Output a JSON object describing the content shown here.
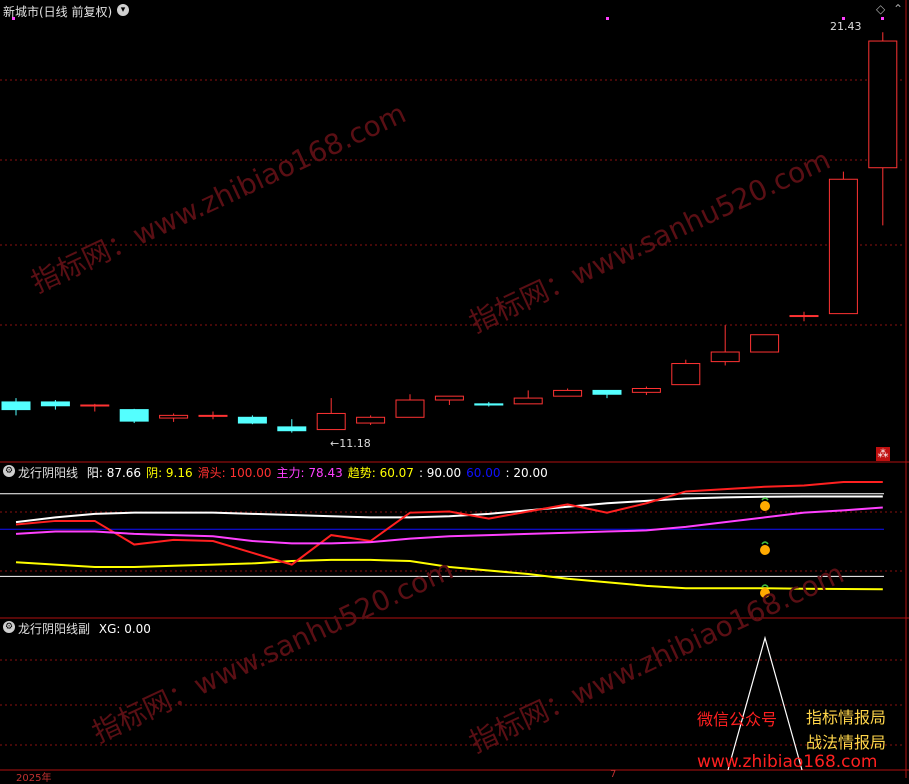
{
  "main_panel": {
    "title": "新城市(日线 前复权)",
    "price_high_label": "21.43",
    "price_low_label": "←11.18",
    "corner_icon": "diamond-icon",
    "collapse_icon": "chevron-down-icon",
    "close_badge_icon": "close-icon"
  },
  "indicator_panel": {
    "name": "龙行阴阳线",
    "items": [
      {
        "label": "阳:",
        "value": "87.66",
        "color": "#ffffff"
      },
      {
        "label": "阴:",
        "value": "9.16",
        "color": "#ffff00"
      },
      {
        "label": "滑头:",
        "value": "100.00",
        "color": "#ff3030"
      },
      {
        "label": "主力:",
        "value": "78.43",
        "color": "#ff40ff"
      },
      {
        "label": "趋势:",
        "value": "60.07",
        "color": "#ffff00"
      },
      {
        "label": "",
        "value": ": 90.00",
        "color": "#ffffff"
      },
      {
        "label": "",
        "value": "60.00",
        "color": "#1010ff"
      },
      {
        "label": "",
        "value": ": 20.00",
        "color": "#ffffff"
      }
    ]
  },
  "sub_panel": {
    "name": "龙行阴阳线副",
    "items": [
      {
        "label": "XG:",
        "value": "0.00",
        "color": "#ffffff"
      }
    ]
  },
  "watermarks": [
    "指标网：www.zhibiao168.com",
    "指标网：www.sanhu520.com",
    "指标网：www.sanhu520.com",
    "指标网：www.zhibiao168.com"
  ],
  "promo": {
    "wechat_label": "微信公众号",
    "account_1": "指标情报局",
    "account_2": "战法情报局",
    "site": "www.zhibiao168.com"
  },
  "bottom_axis": {
    "year": "2025年",
    "month": "7"
  },
  "colors": {
    "up": "#ff3333",
    "down": "#54ffff",
    "grid": "#8a1010"
  },
  "chart_data": {
    "type": "candlestick",
    "candles": [
      {
        "o": 11.8,
        "h": 11.9,
        "l": 11.45,
        "c": 11.6
      },
      {
        "o": 11.8,
        "h": 11.85,
        "l": 11.6,
        "c": 11.7
      },
      {
        "o": 11.7,
        "h": 11.75,
        "l": 11.55,
        "c": 11.72
      },
      {
        "o": 11.6,
        "h": 11.62,
        "l": 11.25,
        "c": 11.3
      },
      {
        "o": 11.38,
        "h": 11.5,
        "l": 11.28,
        "c": 11.45
      },
      {
        "o": 11.45,
        "h": 11.55,
        "l": 11.35,
        "c": 11.45
      },
      {
        "o": 11.4,
        "h": 11.45,
        "l": 11.22,
        "c": 11.25
      },
      {
        "o": 11.15,
        "h": 11.35,
        "l": 11.0,
        "c": 11.05
      },
      {
        "o": 11.08,
        "h": 11.9,
        "l": 11.08,
        "c": 11.5
      },
      {
        "o": 11.25,
        "h": 11.45,
        "l": 11.2,
        "c": 11.4
      },
      {
        "o": 11.4,
        "h": 12.0,
        "l": 11.4,
        "c": 11.85
      },
      {
        "o": 11.85,
        "h": 11.95,
        "l": 11.72,
        "c": 11.95
      },
      {
        "o": 11.75,
        "h": 11.8,
        "l": 11.68,
        "c": 11.72
      },
      {
        "o": 11.75,
        "h": 12.1,
        "l": 11.75,
        "c": 11.9
      },
      {
        "o": 11.95,
        "h": 12.15,
        "l": 11.95,
        "c": 12.1
      },
      {
        "o": 12.1,
        "h": 12.1,
        "l": 11.9,
        "c": 12.0
      },
      {
        "o": 12.05,
        "h": 12.2,
        "l": 11.98,
        "c": 12.15
      },
      {
        "o": 12.25,
        "h": 12.9,
        "l": 12.25,
        "c": 12.8
      },
      {
        "o": 12.85,
        "h": 13.8,
        "l": 12.75,
        "c": 13.1
      },
      {
        "o": 13.1,
        "h": 13.55,
        "l": 13.1,
        "c": 13.55
      },
      {
        "o": 14.05,
        "h": 14.15,
        "l": 13.9,
        "c": 14.05
      },
      {
        "o": 14.1,
        "h": 17.8,
        "l": 14.1,
        "c": 17.6
      },
      {
        "o": 17.9,
        "h": 21.43,
        "l": 16.4,
        "c": 21.2
      }
    ],
    "indicator": {
      "lines": {
        "yang": [
          66,
          70,
          73,
          74,
          74,
          74,
          73,
          72,
          71,
          70,
          70,
          71,
          73,
          76,
          79,
          82,
          84,
          86,
          87,
          87.5,
          87.66,
          87.66,
          87.66
        ],
        "yin": [
          32,
          30,
          28,
          28,
          29,
          30,
          31,
          33,
          34,
          34,
          33,
          28,
          25,
          22,
          18,
          15,
          12,
          10,
          10,
          10,
          9.5,
          9.3,
          9.16
        ],
        "huatou": [
          64,
          67,
          67,
          47,
          51,
          50,
          40,
          30,
          55,
          50,
          74,
          75,
          69,
          75,
          81,
          74,
          82,
          92,
          94,
          96,
          97,
          100,
          100
        ],
        "zhuli": [
          56,
          58,
          58,
          56,
          55,
          54,
          50,
          48,
          48,
          49,
          52,
          54,
          55,
          56,
          57,
          58,
          59,
          62,
          66,
          70,
          74,
          76,
          78.43
        ]
      },
      "ref_levels": [
        90,
        60,
        20
      ]
    },
    "sub_indicator": {
      "xg_peak": 1
    }
  }
}
